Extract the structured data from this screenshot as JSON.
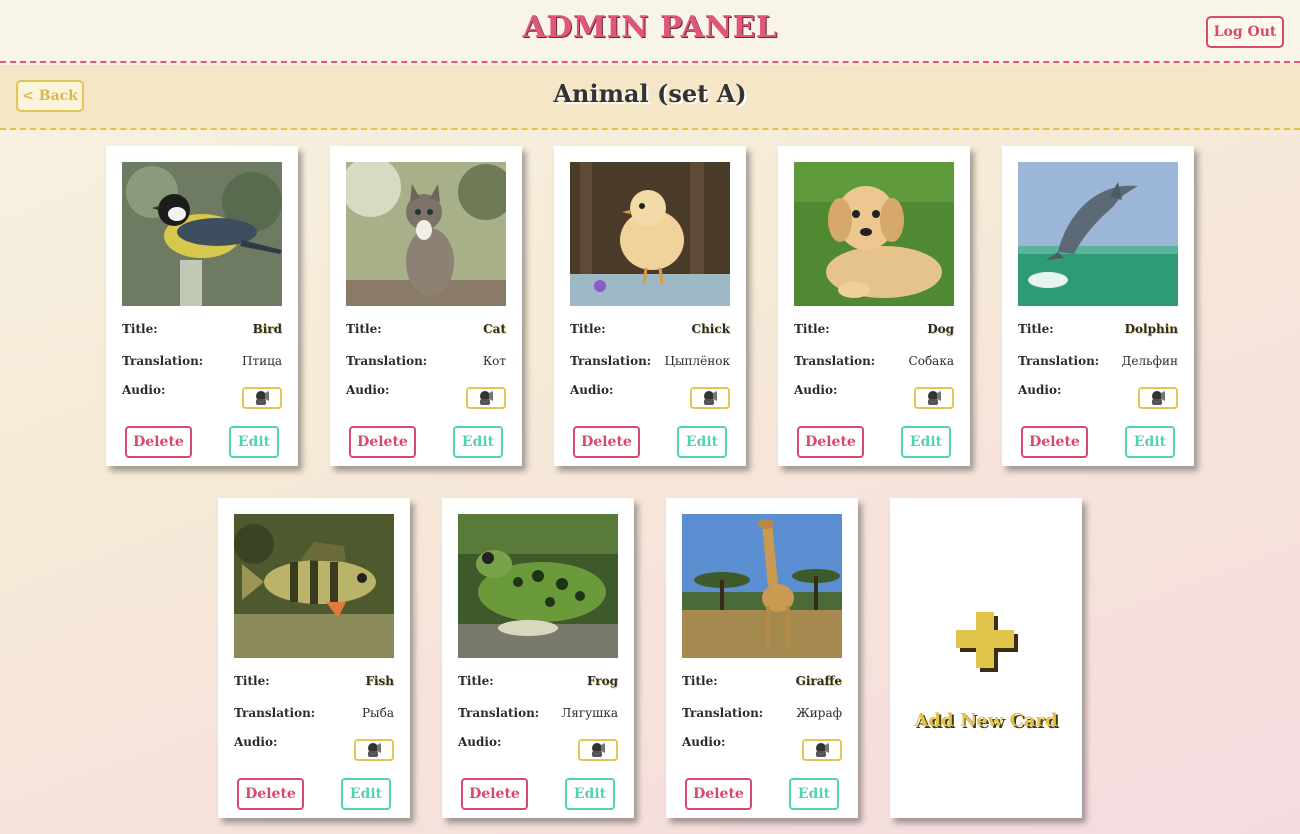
{
  "header": {
    "title": "ADMIN PANEL",
    "logout_label": "Log Out"
  },
  "subheader": {
    "back_label": "< Back",
    "category_title": "Animal (set A)"
  },
  "labels": {
    "title": "Title:",
    "translation": "Translation:",
    "audio": "Audio:",
    "delete": "Delete",
    "edit": "Edit",
    "audio_icon": "speaker-icon"
  },
  "cards": [
    {
      "title": "Bird",
      "translation": "Птица",
      "image": "bird-photo"
    },
    {
      "title": "Cat",
      "translation": "Кот",
      "image": "cat-photo"
    },
    {
      "title": "Chick",
      "translation": "Цыплёнок",
      "image": "chick-photo"
    },
    {
      "title": "Dog",
      "translation": "Собака",
      "image": "dog-photo"
    },
    {
      "title": "Dolphin",
      "translation": "Дельфин",
      "image": "dolphin-photo"
    },
    {
      "title": "Fish",
      "translation": "Рыба",
      "image": "fish-photo"
    },
    {
      "title": "Frog",
      "translation": "Лягушка",
      "image": "frog-photo"
    },
    {
      "title": "Giraffe",
      "translation": "Жираф",
      "image": "giraffe-photo"
    }
  ],
  "add_card": {
    "label": "Add New Card",
    "icon": "plus-icon"
  },
  "colors": {
    "pink": "#d84a6c",
    "teal": "#52d3b4",
    "gold": "#e3c24a"
  }
}
